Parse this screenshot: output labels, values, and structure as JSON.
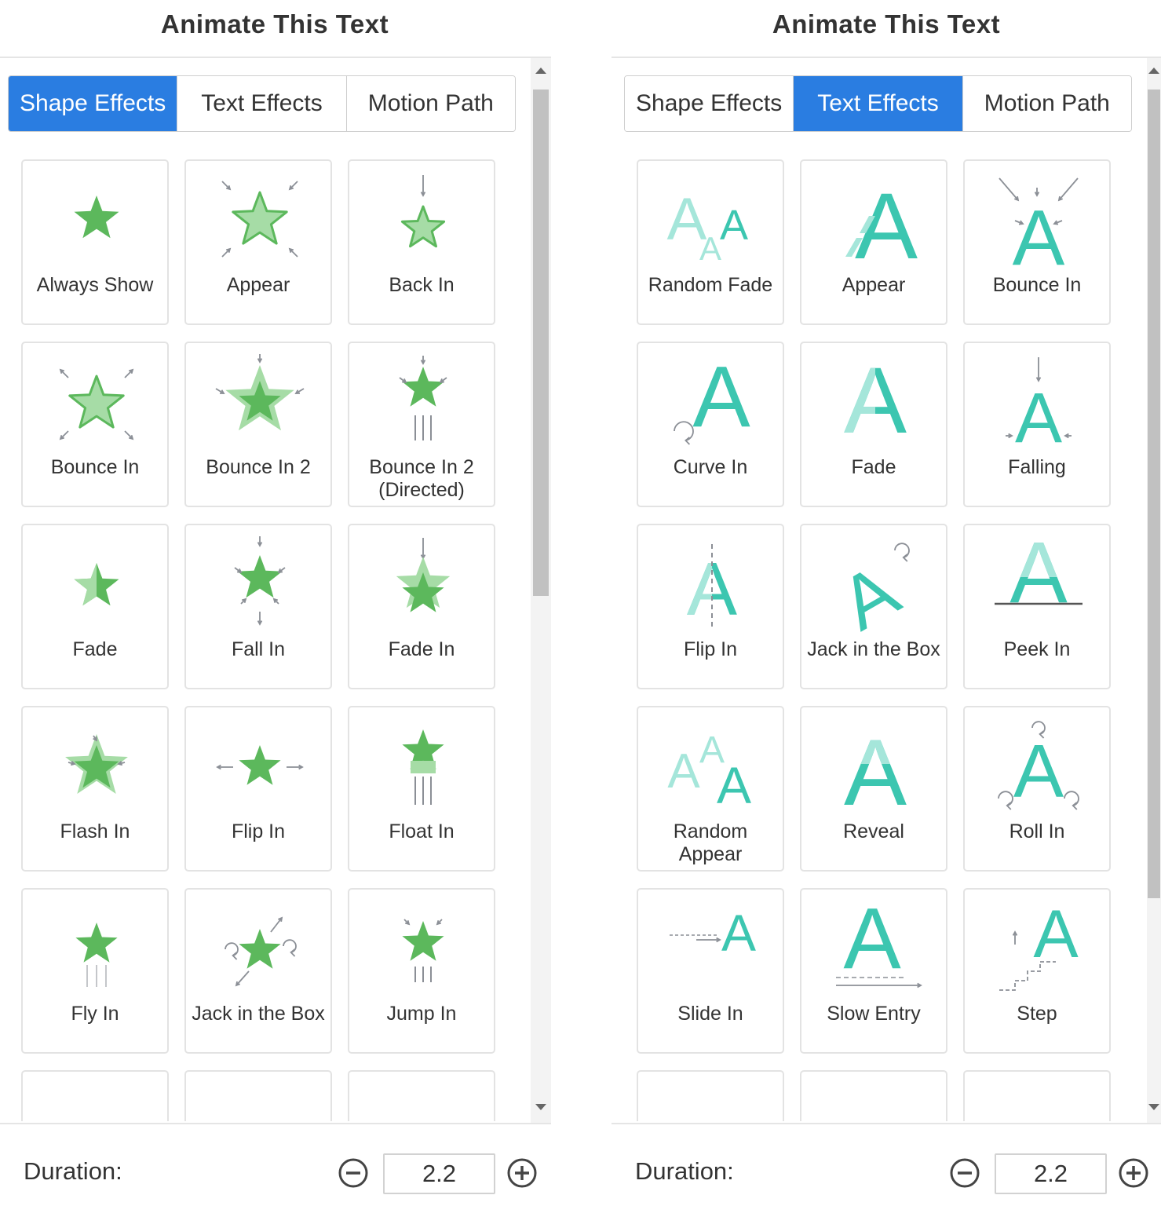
{
  "colors": {
    "accent": "#2a7de1",
    "star_green": "#5cb85c",
    "star_light": "#a6dca6",
    "text_teal": "#3cc6b0",
    "text_teal_light": "#a5e6da",
    "arrow_gray": "#8b8f96"
  },
  "left_panel": {
    "title": "Animate This Text",
    "tabs": [
      {
        "label": "Shape Effects",
        "active": true
      },
      {
        "label": "Text Effects",
        "active": false
      },
      {
        "label": "Motion Path",
        "active": false
      }
    ],
    "scroll_fraction": 0.0,
    "effects": [
      {
        "label": "Always Show",
        "icon": "star-icon"
      },
      {
        "label": "Appear",
        "icon": "star-appear-icon"
      },
      {
        "label": "Back In",
        "icon": "star-back-in-icon"
      },
      {
        "label": "Bounce In",
        "icon": "star-bounce-in-icon"
      },
      {
        "label": "Bounce In 2",
        "icon": "star-bounce-in-2-icon"
      },
      {
        "label": "Bounce In 2 (Directed)",
        "icon": "star-bounce-directed-icon"
      },
      {
        "label": "Fade",
        "icon": "star-fade-icon"
      },
      {
        "label": "Fall In",
        "icon": "star-fall-in-icon"
      },
      {
        "label": "Fade In",
        "icon": "star-fade-in-icon"
      },
      {
        "label": "Flash In",
        "icon": "star-flash-in-icon"
      },
      {
        "label": "Flip In",
        "icon": "star-flip-in-icon"
      },
      {
        "label": "Float In",
        "icon": "star-float-in-icon"
      },
      {
        "label": "Fly In",
        "icon": "star-fly-in-icon"
      },
      {
        "label": "Jack in the Box",
        "icon": "star-jack-in-the-box-icon"
      },
      {
        "label": "Jump In",
        "icon": "star-jump-in-icon"
      },
      {
        "label": "",
        "icon": "star-partial-icon"
      },
      {
        "label": "",
        "icon": "star-partial-icon"
      },
      {
        "label": "",
        "icon": "star-partial-icon"
      }
    ],
    "duration": {
      "label": "Duration:",
      "value": "2.2"
    }
  },
  "right_panel": {
    "title": "Animate This Text",
    "tabs": [
      {
        "label": "Shape Effects",
        "active": false
      },
      {
        "label": "Text Effects",
        "active": true
      },
      {
        "label": "Motion Path",
        "active": false
      }
    ],
    "scroll_fraction": 0.0,
    "effects": [
      {
        "label": "Random Fade",
        "icon": "letter-random-fade-icon"
      },
      {
        "label": "Appear",
        "icon": "letter-appear-icon"
      },
      {
        "label": "Bounce In",
        "icon": "letter-bounce-in-icon"
      },
      {
        "label": "Curve In",
        "icon": "letter-curve-in-icon"
      },
      {
        "label": "Fade",
        "icon": "letter-fade-icon"
      },
      {
        "label": "Falling",
        "icon": "letter-falling-icon"
      },
      {
        "label": "Flip In",
        "icon": "letter-flip-in-icon"
      },
      {
        "label": "Jack in the Box",
        "icon": "letter-jack-in-the-box-icon"
      },
      {
        "label": "Peek In",
        "icon": "letter-peek-in-icon"
      },
      {
        "label": "Random Appear",
        "icon": "letter-random-appear-icon"
      },
      {
        "label": "Reveal",
        "icon": "letter-reveal-icon"
      },
      {
        "label": "Roll In",
        "icon": "letter-roll-in-icon"
      },
      {
        "label": "Slide In",
        "icon": "letter-slide-in-icon"
      },
      {
        "label": "Slow Entry",
        "icon": "letter-slow-entry-icon"
      },
      {
        "label": "Step",
        "icon": "letter-step-icon"
      },
      {
        "label": "",
        "icon": "letter-partial-icon"
      },
      {
        "label": "",
        "icon": "letter-partial-icon"
      },
      {
        "label": "",
        "icon": "letter-partial-icon"
      }
    ],
    "duration": {
      "label": "Duration:",
      "value": "2.2"
    }
  }
}
